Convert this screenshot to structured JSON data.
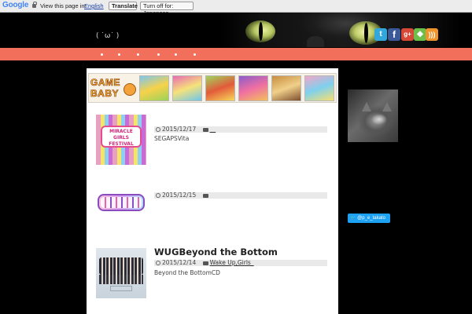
{
  "translate_bar": {
    "logo": "Google",
    "message": "View this page in:",
    "language": "English",
    "translate_label": "Translate",
    "turn_off_label": "Turn off for: Japanese"
  },
  "site": {
    "title": "( ˙ω˙ )"
  },
  "social_icons": [
    "twitter-icon",
    "facebook-icon",
    "google-plus-icon",
    "feedly-icon",
    "rss-icon"
  ],
  "ad_banner": {
    "logo_text": "GAME BABY"
  },
  "posts": [
    {
      "date": "2015/12/17",
      "category": "__",
      "title": "",
      "excerpt": "SEGAPSVita"
    },
    {
      "date": "2015/12/15",
      "category": "",
      "title": "",
      "excerpt": ""
    },
    {
      "date": "2015/12/14",
      "category": "Wake Up,Girls_",
      "title": "WUGBeyond the Bottom",
      "excerpt": "Beyond the BottomCD"
    }
  ],
  "sidebar": {
    "follow_label": "@p_e_takato"
  },
  "colors": {
    "nav_bar": "#f26f5c",
    "background": "#000000"
  }
}
